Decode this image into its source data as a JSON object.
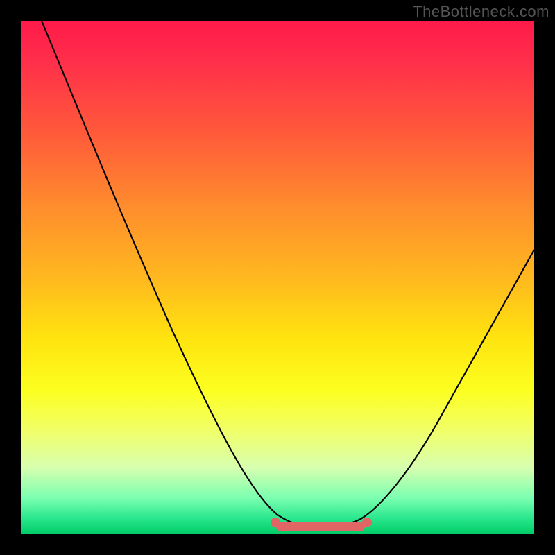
{
  "watermark": "TheBottleneck.com",
  "colors": {
    "frame": "#000000",
    "curve_stroke": "#000000",
    "marker": "#e06666",
    "gradient_top": "#ff1a4a",
    "gradient_bottom": "#00cc66"
  },
  "chart_data": {
    "type": "line",
    "title": "",
    "xlabel": "",
    "ylabel": "",
    "xlim": [
      0,
      100
    ],
    "ylim": [
      0,
      100
    ],
    "series": [
      {
        "name": "bottleneck-curve",
        "x": [
          4,
          10,
          15,
          20,
          25,
          30,
          35,
          40,
          45,
          48,
          50,
          53,
          55,
          58,
          60,
          63,
          66,
          70,
          75,
          80,
          85,
          90,
          95,
          100
        ],
        "y": [
          100,
          88,
          79,
          70,
          62,
          53,
          44,
          35,
          25,
          16,
          10,
          5,
          3,
          2,
          2,
          2,
          2,
          3,
          6,
          12,
          20,
          30,
          42,
          56
        ]
      }
    ],
    "optimal_range": {
      "x_start": 50,
      "x_end": 67,
      "y": 2
    },
    "annotations": []
  }
}
